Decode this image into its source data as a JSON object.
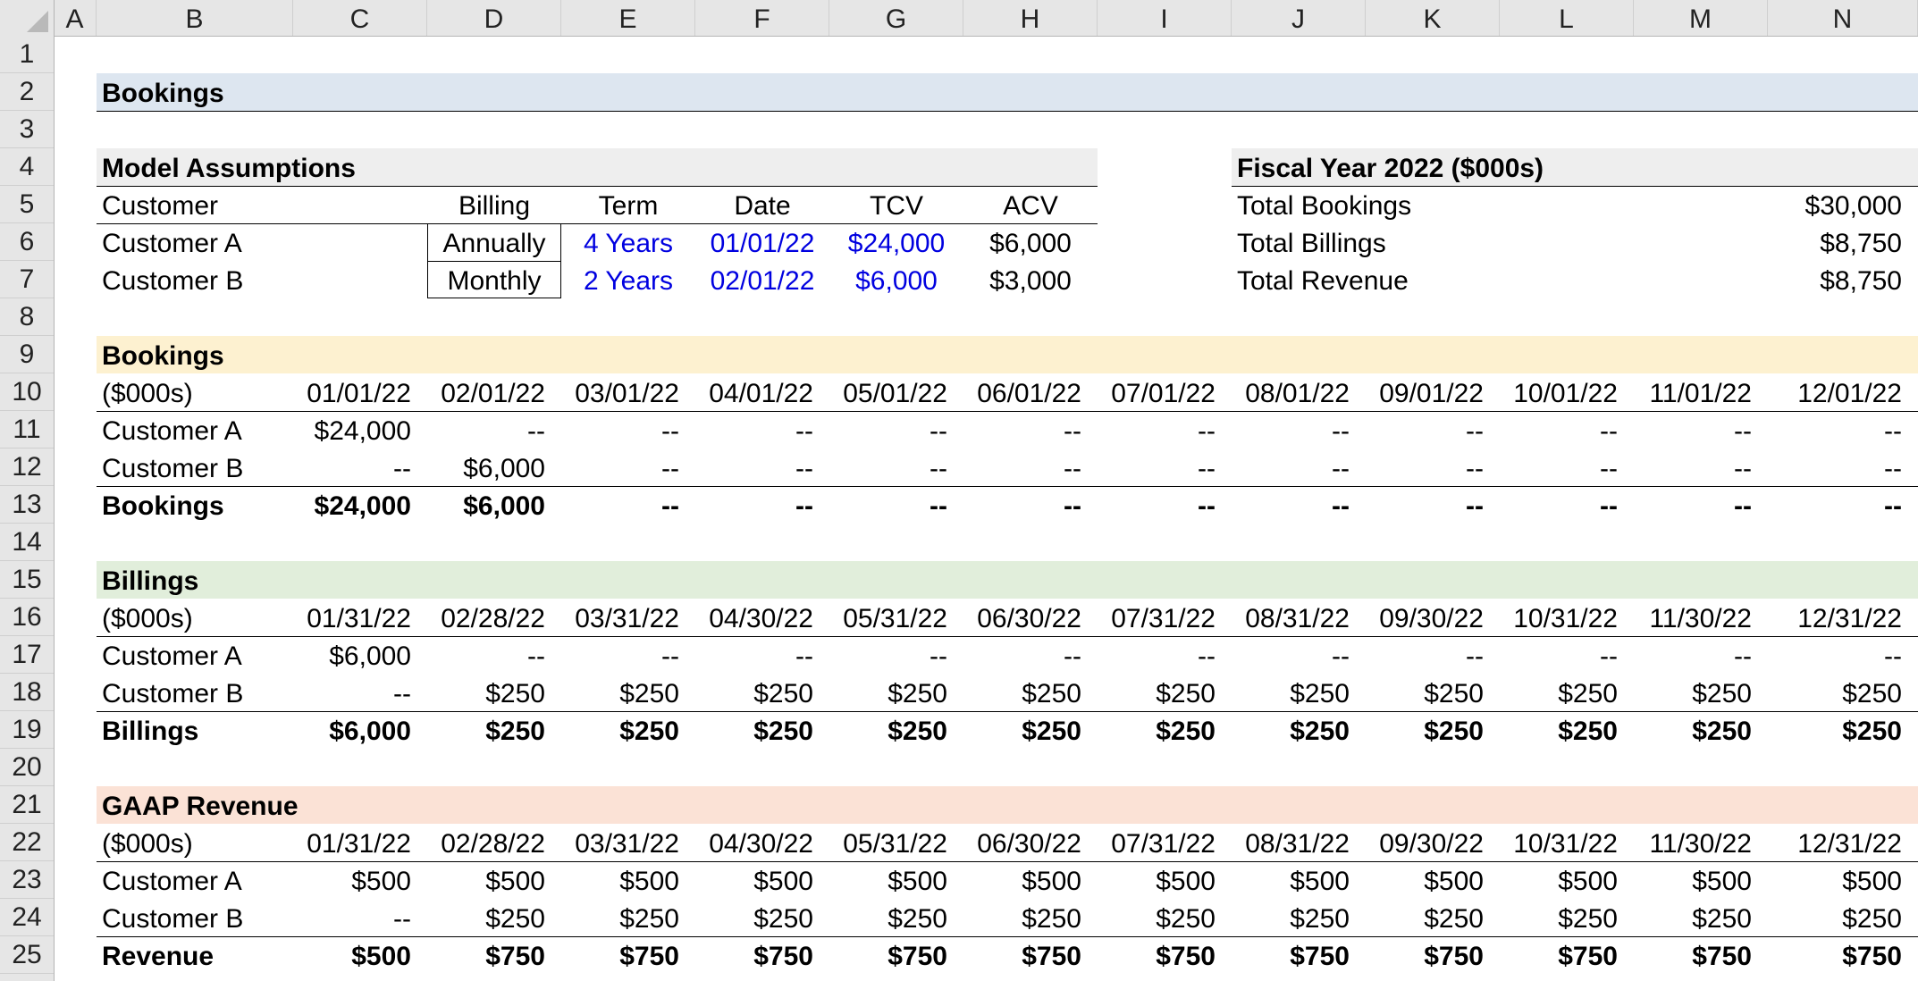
{
  "columns": [
    "A",
    "B",
    "C",
    "D",
    "E",
    "F",
    "G",
    "H",
    "I",
    "J",
    "K",
    "L",
    "M",
    "N"
  ],
  "rows": [
    "1",
    "2",
    "3",
    "4",
    "5",
    "6",
    "7",
    "8",
    "9",
    "10",
    "11",
    "12",
    "13",
    "14",
    "15",
    "16",
    "17",
    "18",
    "19",
    "20",
    "21",
    "22",
    "23",
    "24",
    "25"
  ],
  "colors": {
    "bookings_band": "#dde6f0",
    "model_band": "#eeeeee",
    "bookings_sched_band": "#fdf1d0",
    "billings_band": "#e1eedb",
    "revenue_band": "#fbe2d6",
    "input_blue": "#0000e0"
  },
  "title": "Bookings",
  "assumptions": {
    "title": "Model Assumptions",
    "headers": [
      "Customer",
      "Billing",
      "Term",
      "Date",
      "TCV",
      "ACV"
    ],
    "rows": [
      [
        "Customer A",
        "Annually",
        "4 Years",
        "01/01/22",
        "$24,000",
        "$6,000"
      ],
      [
        "Customer B",
        "Monthly",
        "2 Years",
        "02/01/22",
        "$6,000",
        "$3,000"
      ]
    ]
  },
  "fiscal": {
    "title": "Fiscal Year 2022 ($000s)",
    "rows": [
      [
        "Total Bookings",
        "$30,000"
      ],
      [
        "Total Billings",
        "$8,750"
      ],
      [
        "Total Revenue",
        "$8,750"
      ]
    ]
  },
  "bookings": {
    "title": "Bookings",
    "unit": "($000s)",
    "dates": [
      "01/01/22",
      "02/01/22",
      "03/01/22",
      "04/01/22",
      "05/01/22",
      "06/01/22",
      "07/01/22",
      "08/01/22",
      "09/01/22",
      "10/01/22",
      "11/01/22",
      "12/01/22"
    ],
    "rows": [
      {
        "label": "Customer A",
        "values": [
          "$24,000",
          "--",
          "--",
          "--",
          "--",
          "--",
          "--",
          "--",
          "--",
          "--",
          "--",
          "--"
        ]
      },
      {
        "label": "Customer B",
        "values": [
          "--",
          "$6,000",
          "--",
          "--",
          "--",
          "--",
          "--",
          "--",
          "--",
          "--",
          "--",
          "--"
        ]
      }
    ],
    "total": {
      "label": "Bookings",
      "values": [
        "$24,000",
        "$6,000",
        "--",
        "--",
        "--",
        "--",
        "--",
        "--",
        "--",
        "--",
        "--",
        "--"
      ]
    }
  },
  "billings": {
    "title": "Billings",
    "unit": "($000s)",
    "dates": [
      "01/31/22",
      "02/28/22",
      "03/31/22",
      "04/30/22",
      "05/31/22",
      "06/30/22",
      "07/31/22",
      "08/31/22",
      "09/30/22",
      "10/31/22",
      "11/30/22",
      "12/31/22"
    ],
    "rows": [
      {
        "label": "Customer A",
        "values": [
          "$6,000",
          "--",
          "--",
          "--",
          "--",
          "--",
          "--",
          "--",
          "--",
          "--",
          "--",
          "--"
        ]
      },
      {
        "label": "Customer B",
        "values": [
          "--",
          "$250",
          "$250",
          "$250",
          "$250",
          "$250",
          "$250",
          "$250",
          "$250",
          "$250",
          "$250",
          "$250"
        ]
      }
    ],
    "total": {
      "label": "Billings",
      "values": [
        "$6,000",
        "$250",
        "$250",
        "$250",
        "$250",
        "$250",
        "$250",
        "$250",
        "$250",
        "$250",
        "$250",
        "$250"
      ]
    }
  },
  "revenue": {
    "title": "GAAP Revenue",
    "unit": "($000s)",
    "dates": [
      "01/31/22",
      "02/28/22",
      "03/31/22",
      "04/30/22",
      "05/31/22",
      "06/30/22",
      "07/31/22",
      "08/31/22",
      "09/30/22",
      "10/31/22",
      "11/30/22",
      "12/31/22"
    ],
    "rows": [
      {
        "label": "Customer A",
        "values": [
          "$500",
          "$500",
          "$500",
          "$500",
          "$500",
          "$500",
          "$500",
          "$500",
          "$500",
          "$500",
          "$500",
          "$500"
        ]
      },
      {
        "label": "Customer B",
        "values": [
          "--",
          "$250",
          "$250",
          "$250",
          "$250",
          "$250",
          "$250",
          "$250",
          "$250",
          "$250",
          "$250",
          "$250"
        ]
      }
    ],
    "total": {
      "label": "Revenue",
      "values": [
        "$500",
        "$750",
        "$750",
        "$750",
        "$750",
        "$750",
        "$750",
        "$750",
        "$750",
        "$750",
        "$750",
        "$750"
      ]
    }
  }
}
